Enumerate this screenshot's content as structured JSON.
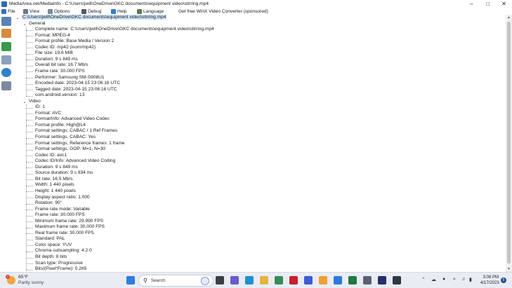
{
  "window": {
    "title": "MediaArea.net/MediaInfo - C:\\Users\\jwill\\OneDrive\\GKC documents\\equipment video\\stirring.mp4"
  },
  "menu": [
    {
      "label": "File",
      "icon": "file-icon",
      "color": "#3c6fb8"
    },
    {
      "label": "View",
      "icon": "view-icon",
      "color": "#6a7a8a"
    },
    {
      "label": "Options",
      "icon": "options-icon",
      "color": "#7a8a9a"
    },
    {
      "label": "Debug",
      "icon": "debug-icon",
      "color": "#505a66"
    },
    {
      "label": "Help",
      "icon": "help-icon",
      "color": "#2f7fd1"
    },
    {
      "label": "Language",
      "icon": "language-icon",
      "color": "#5a7a4a"
    },
    {
      "label": "Get free WinX Video Converter (sponsored)",
      "icon": "",
      "color": ""
    }
  ],
  "toolbar": [
    {
      "name": "open-file-icon",
      "color": "#5a82b8"
    },
    {
      "name": "open-folder-icon",
      "color": "#d98b3a"
    },
    {
      "name": "export-icon",
      "color": "#3a9a4a"
    },
    {
      "name": "sheet-icon",
      "color": "#8aa0c0"
    },
    {
      "name": "info-icon",
      "color": "#2f7fd1"
    },
    {
      "name": "preferences-icon",
      "color": "#7a8aa0"
    }
  ],
  "tree": {
    "root": "C:\\Users\\jwill\\OneDrive\\GKC documents\\equipment video\\stirring.mp4",
    "sections": [
      {
        "name": "General",
        "items": [
          "Complete name: C:\\Users\\jwill\\OneDrive\\GKC documents\\equipment video\\stirring.mp4",
          "Format: MPEG-4",
          "Format profile: Base Media / Version 2",
          "Codec ID: mp42 (isom/mp42)",
          "File size: 19.6 MiB",
          "Duration: 9 s 849 ms",
          "Overall bit rate: 16.7 Mb/s",
          "Frame rate: 30.000 FPS",
          "Performer: Samsung SM-S908U1",
          "Encoded date: 2023-04-15 23:06:16 UTC",
          "Tagged date: 2023-04-15 23:06:16 UTC",
          "com.android.version: 13"
        ]
      },
      {
        "name": "Video",
        "items": [
          "ID: 1",
          "Format: AVC",
          "Format/Info: Advanced Video Codec",
          "Format profile: High@L4",
          "Format settings: CABAC / 1 Ref Frames",
          "Format settings, CABAC: Yes",
          "Format settings, Reference frames: 1 frame",
          "Format settings, GOP: M=1, N=30",
          "Codec ID: avc1",
          "Codec ID/Info: Advanced Video Coding",
          "Duration: 9 s 849 ms",
          "Source duration: 9 s 834 ms",
          "Bit rate: 16.5 Mb/s",
          "Width: 1 440 pixels",
          "Height: 1 440 pixels",
          "Display aspect ratio: 1.000",
          "Rotation: 90°",
          "Frame rate mode: Variable",
          "Frame rate: 30.000 FPS",
          "Minimum frame rate: 29.990 FPS",
          "Maximum frame rate: 30.000 FPS",
          "Real frame rate: 30.000 FPS",
          "Standard: PAL",
          "Color space: YUV",
          "Chroma subsampling: 4:2:0",
          "Bit depth: 8 bits",
          "Scan type: Progressive",
          "Bits/(Pixel*Frame): 0.265"
        ]
      }
    ]
  },
  "taskbar": {
    "weather_temp": "65°F",
    "weather_desc": "Partly sunny",
    "weather_badge": "1",
    "search_placeholder": "Search",
    "apps": [
      {
        "name": "windows-start-icon",
        "color": "#2b7de1"
      },
      {
        "name": "task-view-icon",
        "color": "#3a3f48"
      },
      {
        "name": "chat-icon",
        "color": "#6a5acd"
      },
      {
        "name": "edge-icon",
        "color": "#1f8fd6"
      },
      {
        "name": "file-explorer-icon",
        "color": "#e8b43a"
      },
      {
        "name": "store-icon",
        "color": "#3a8a5a"
      },
      {
        "name": "mcafee-icon",
        "color": "#c8202f"
      },
      {
        "name": "ds-app-icon",
        "color": "#3b5bdb"
      },
      {
        "name": "edit-app-icon",
        "color": "#f0a030"
      },
      {
        "name": "mail-icon",
        "color": "#2a7ad8"
      },
      {
        "name": "excel-icon",
        "color": "#1f7a3f"
      },
      {
        "name": "settings-icon",
        "color": "#5a6070"
      },
      {
        "name": "media-app-icon",
        "color": "#23306b"
      },
      {
        "name": "mediainfo-icon",
        "color": "#303640"
      }
    ],
    "time": "3:08 PM",
    "date": "4/17/2023",
    "notification_count": "5"
  }
}
